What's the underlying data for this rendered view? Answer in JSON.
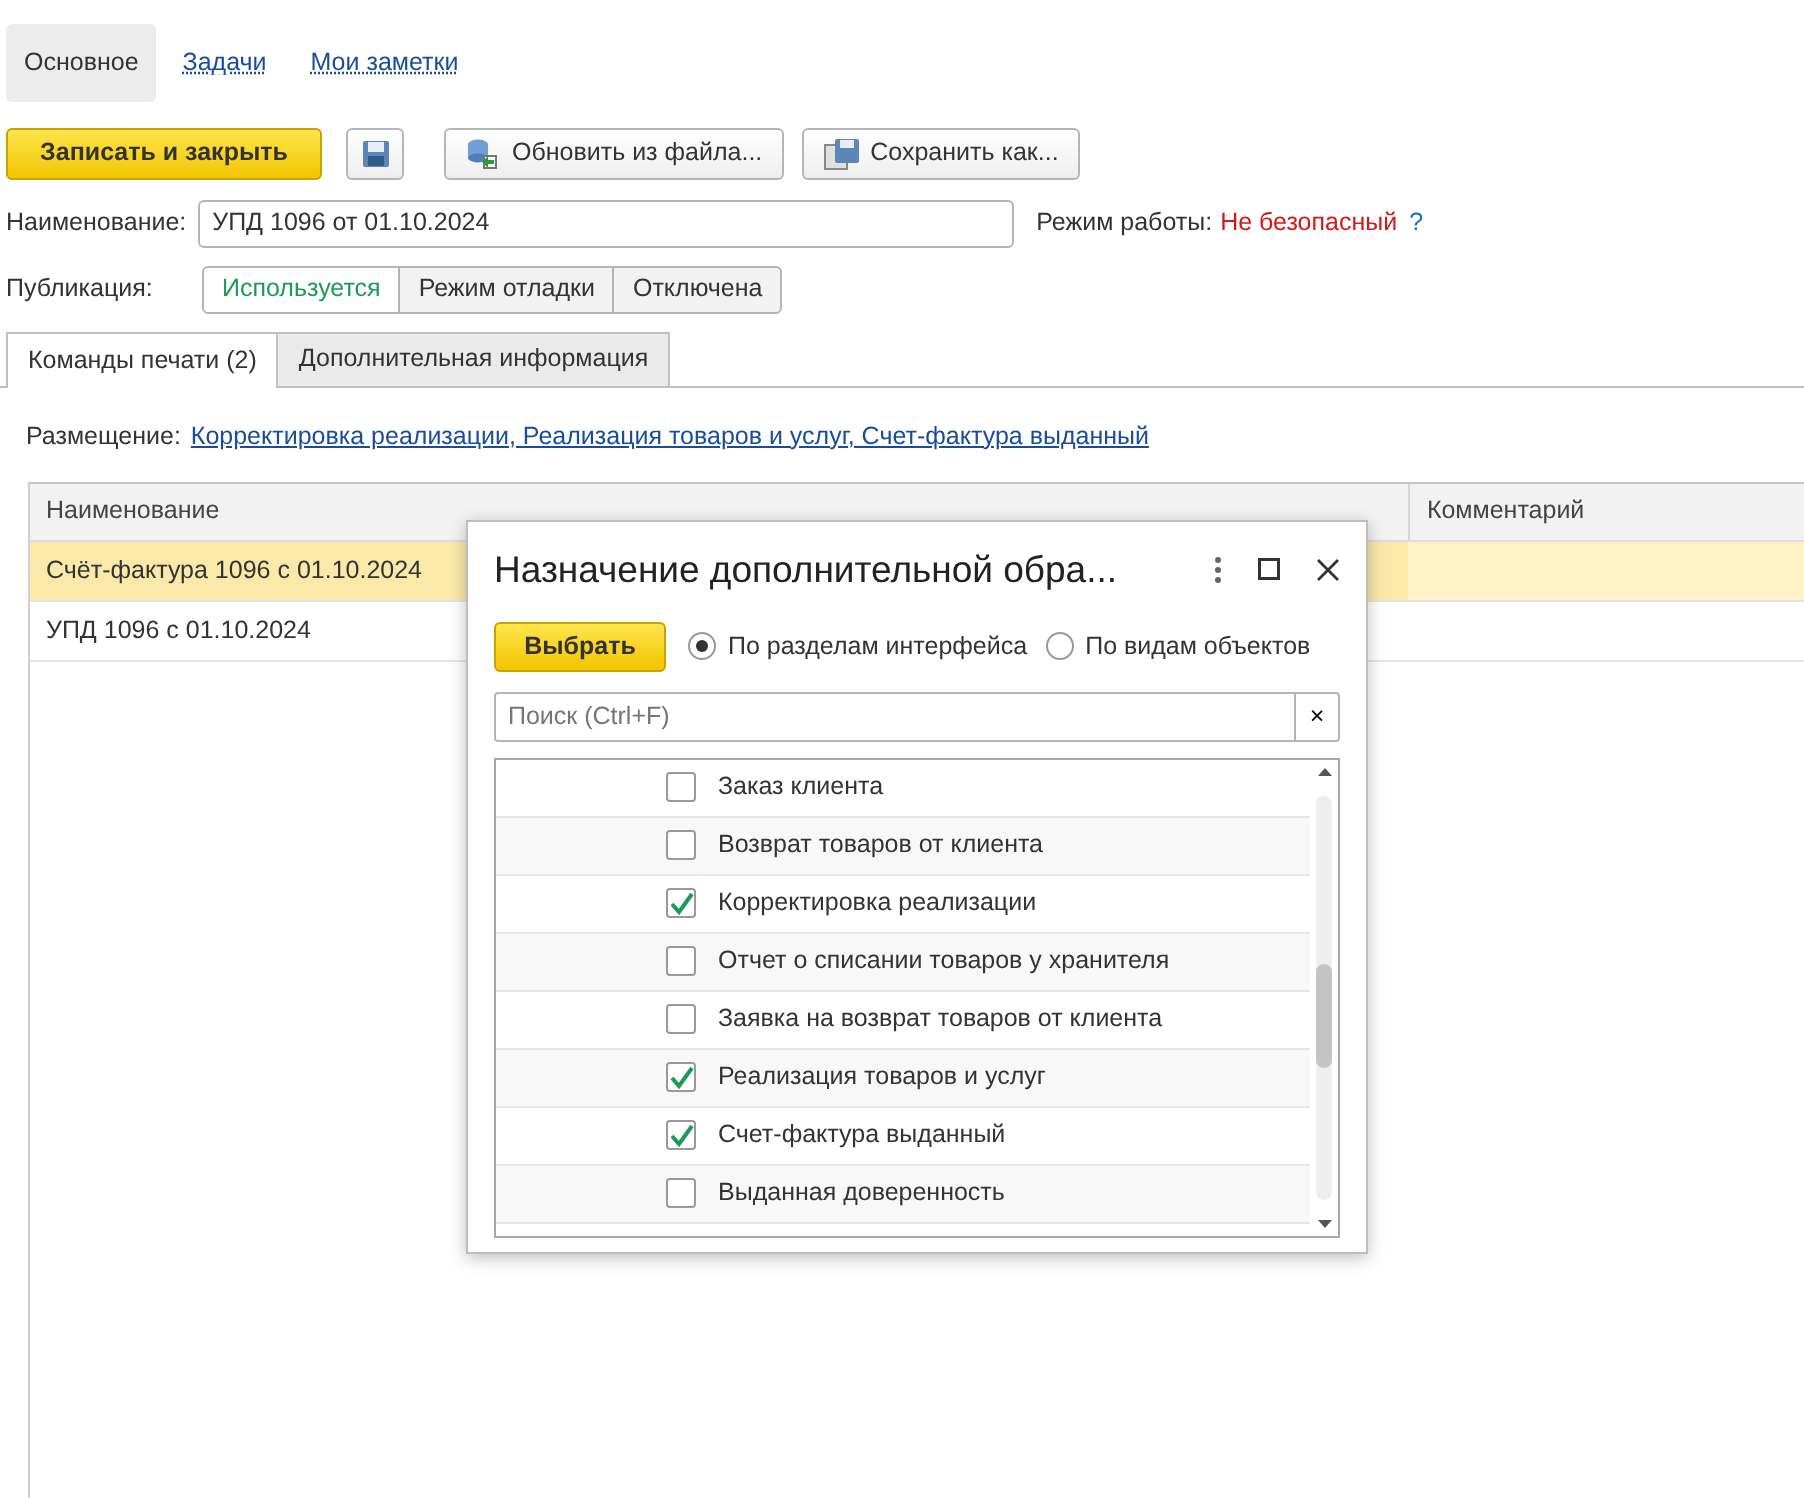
{
  "form_tabs": [
    {
      "label": "Основное",
      "selected": true
    },
    {
      "label": "Задачи",
      "selected": false
    },
    {
      "label": "Мои заметки",
      "selected": false
    }
  ],
  "toolbar": {
    "primary": "Записать и закрыть",
    "buttons": [
      {
        "kind": "refresh",
        "label": "Обновить из файла..."
      },
      {
        "kind": "saveas",
        "label": "Сохранить как..."
      }
    ]
  },
  "name_field": {
    "label": "Наименование:",
    "value": "УПД 1096 от 01.10.2024"
  },
  "mode": {
    "label": "Режим работы:",
    "value": "Не безопасный",
    "help": "?"
  },
  "publication": {
    "label": "Публикация:",
    "options": [
      {
        "label": "Используется",
        "selected": true
      },
      {
        "label": "Режим отладки",
        "selected": false
      },
      {
        "label": "Отключена",
        "selected": false
      }
    ]
  },
  "page_tabs": [
    {
      "label": "Команды печати (2)",
      "selected": true
    },
    {
      "label": "Дополнительная информация",
      "selected": false
    }
  ],
  "placement": {
    "label": "Размещение:",
    "link": "Корректировка реализации, Реализация товаров и услуг, Счет-фактура выданный"
  },
  "table": {
    "columns": [
      "Наименование",
      "Комментарий"
    ],
    "rows": [
      {
        "name": "Счёт-фактура 1096 с 01.10.2024",
        "selected": true
      },
      {
        "name": "УПД 1096 с 01.10.2024",
        "selected": false
      }
    ]
  },
  "dialog": {
    "title": "Назначение дополнительной обра...",
    "select_button": "Выбрать",
    "radios": [
      {
        "label": "По разделам интерфейса",
        "selected": true
      },
      {
        "label": "По видам объектов",
        "selected": false
      }
    ],
    "search": {
      "placeholder": "Поиск (Ctrl+F)",
      "clear": "×"
    },
    "items": [
      {
        "label": "Заказ клиента",
        "checked": false
      },
      {
        "label": "Возврат товаров от клиента",
        "checked": false
      },
      {
        "label": "Корректировка реализации",
        "checked": true
      },
      {
        "label": "Отчет о списании товаров у хранителя",
        "checked": false
      },
      {
        "label": "Заявка на возврат товаров от клиента",
        "checked": false
      },
      {
        "label": "Реализация товаров и услуг",
        "checked": true
      },
      {
        "label": "Счет-фактура выданный",
        "checked": true
      },
      {
        "label": "Выданная доверенность",
        "checked": false
      }
    ]
  }
}
